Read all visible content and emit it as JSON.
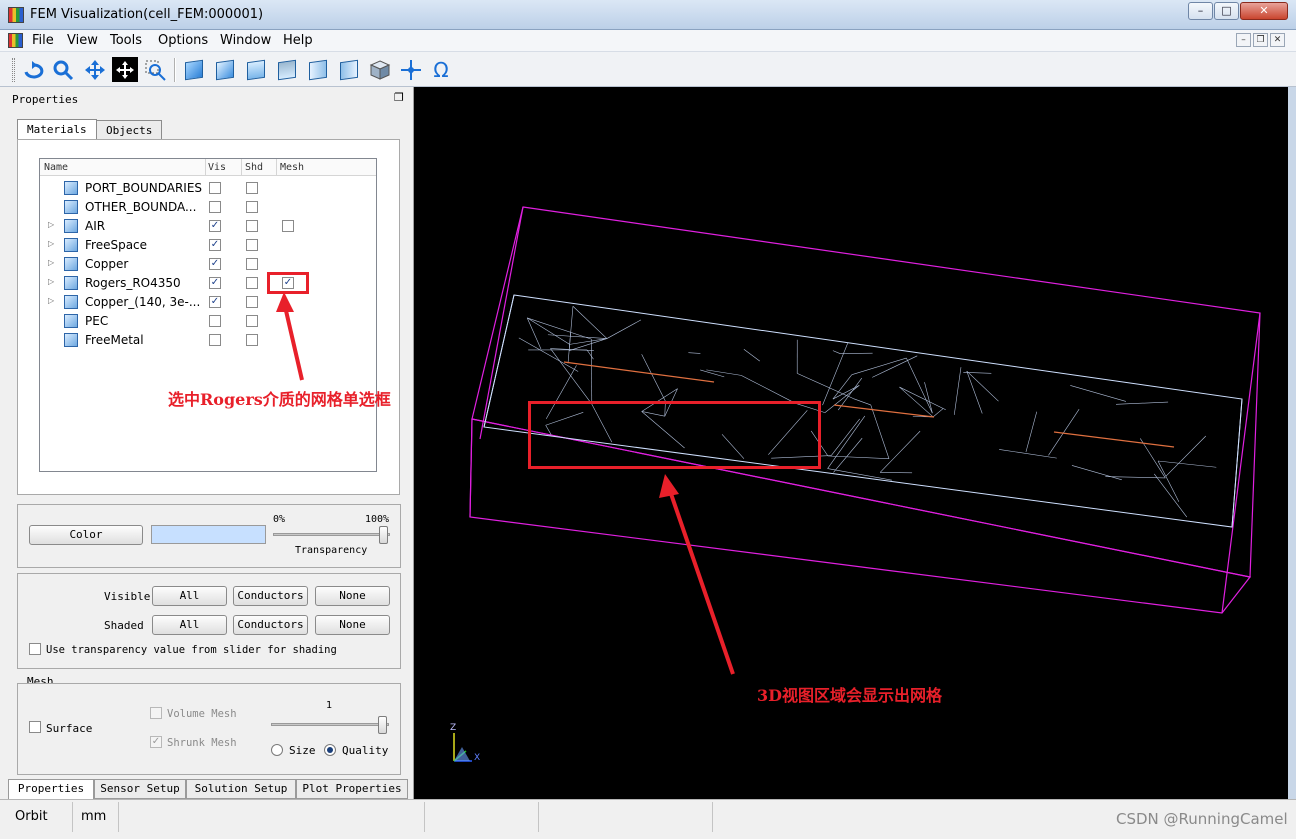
{
  "window": {
    "title": "FEM Visualization(cell_FEM:000001)",
    "controls": {
      "minimize": "–",
      "maximize": "□",
      "close": "✕"
    }
  },
  "menubar": {
    "items": [
      "File",
      "View",
      "Tools",
      "Options",
      "Window",
      "Help"
    ],
    "mdi_controls": {
      "minimize": "–",
      "restore": "❐",
      "close": "✕"
    }
  },
  "toolbar": {
    "icons": [
      "rotate-icon",
      "zoom-icon",
      "pan-icon",
      "select-icon",
      "zoom-window-icon",
      "view-front-icon",
      "view-back-icon",
      "view-top-icon",
      "view-bottom-icon",
      "view-left-icon",
      "view-right-icon",
      "view-iso-icon",
      "crosshair-icon",
      "omega-icon"
    ],
    "omega_glyph": "Ω"
  },
  "properties_panel": {
    "title": "Properties",
    "float_glyph": "❐",
    "tabs": [
      "Materials",
      "Objects"
    ],
    "columns": [
      "Name",
      "Vis",
      "Shd",
      "Mesh"
    ],
    "materials": [
      {
        "name": "PORT_BOUNDARIES",
        "expandable": false,
        "vis": false,
        "shd": false,
        "mesh": null
      },
      {
        "name": "OTHER_BOUNDA...",
        "expandable": false,
        "vis": false,
        "shd": false,
        "mesh": null
      },
      {
        "name": "AIR",
        "expandable": true,
        "vis": true,
        "shd": false,
        "mesh": false
      },
      {
        "name": "FreeSpace",
        "expandable": true,
        "vis": true,
        "shd": false,
        "mesh": null
      },
      {
        "name": "Copper",
        "expandable": true,
        "vis": true,
        "shd": false,
        "mesh": null
      },
      {
        "name": "Rogers_RO4350",
        "expandable": true,
        "vis": true,
        "shd": false,
        "mesh": true
      },
      {
        "name": "Copper_(140, 3e-...",
        "expandable": true,
        "vis": true,
        "shd": false,
        "mesh": null
      },
      {
        "name": "PEC",
        "expandable": false,
        "vis": false,
        "shd": false,
        "mesh": null
      },
      {
        "name": "FreeMetal",
        "expandable": false,
        "vis": false,
        "shd": false,
        "mesh": null
      }
    ],
    "check_glyph": "✓",
    "expand_glyph": "▷",
    "color_group": {
      "color_button": "Color",
      "swatch_color": "#c7e0ff",
      "min_label": "0%",
      "max_label": "100%",
      "transparency_label": "Transparency",
      "transparency_value": 0.95
    },
    "visibility_group": {
      "visible_label": "Visible",
      "shaded_label": "Shaded",
      "all_label": "All",
      "conductors_label": "Conductors",
      "none_label": "None",
      "use_transparency_label": "Use transparency value from slider for shading"
    },
    "mesh_group": {
      "title": "Mesh",
      "surface_label": "Surface",
      "volume_mesh_label": "Volume Mesh",
      "shrunk_mesh_label": "Shrunk Mesh",
      "slider_value": "1",
      "size_label": "Size",
      "quality_label": "Quality",
      "quality_selected": true
    }
  },
  "bottom_tabs": [
    "Properties",
    "Sensor Setup",
    "Solution Setup",
    "Plot Properties"
  ],
  "viewport": {
    "background": "#000000",
    "mesh_color": "#cfe0ff",
    "box_color": "#e020e0",
    "axis_labels": {
      "z": "Z",
      "x": "X"
    }
  },
  "annotations": {
    "checkbox_note": "选中Rogers介质的网格单选框",
    "viewport_note": "3D视图区域会显示出网格",
    "color": "#e8202a"
  },
  "statusbar": {
    "mode": "Orbit",
    "units": "mm",
    "watermark": "CSDN @RunningCamel"
  }
}
